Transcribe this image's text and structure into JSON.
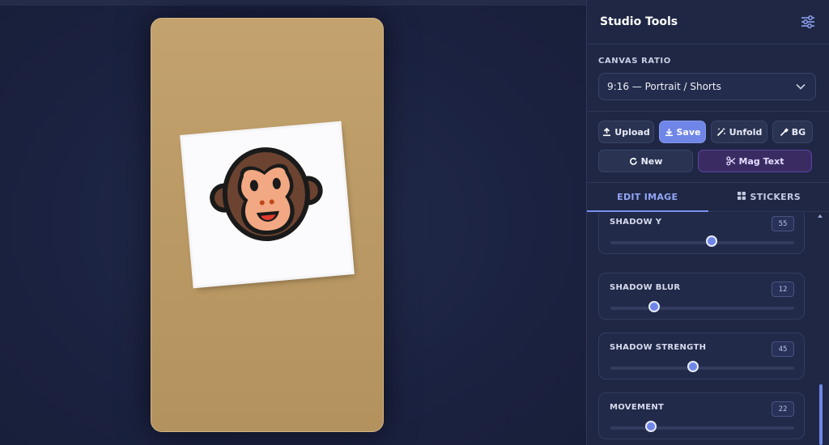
{
  "panel": {
    "title": "Studio Tools",
    "settings_icon": "sliders-icon"
  },
  "canvas_ratio": {
    "label": "CANVAS RATIO",
    "selected": "9:16 — Portrait / Shorts"
  },
  "toolbar": {
    "upload": "Upload",
    "save": "Save",
    "unfold": "Unfold",
    "bg": "BG",
    "new": "New",
    "mag_text": "Mag Text"
  },
  "tabs": [
    {
      "label": "EDIT IMAGE",
      "active": true
    },
    {
      "label": "STICKERS",
      "active": false
    }
  ],
  "sliders": [
    {
      "label": "SHADOW Y",
      "value": "55",
      "fraction": 0.55
    },
    {
      "label": "SHADOW BLUR",
      "value": "12",
      "fraction": 0.24
    },
    {
      "label": "SHADOW STRENGTH",
      "value": "45",
      "fraction": 0.45
    },
    {
      "label": "MOVEMENT",
      "value": "22",
      "fraction": 0.22
    }
  ],
  "colors": {
    "accent": "#6f86e8",
    "canvas_bg": "#c0a06b",
    "panel_bg": "#1f2745",
    "magic_button": "#3a2c63"
  },
  "sticker": {
    "icon": "monkey-face-icon"
  }
}
